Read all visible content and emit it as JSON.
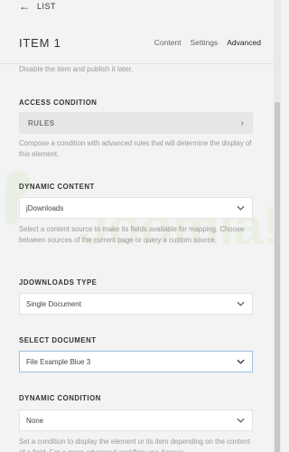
{
  "nav": {
    "back_label": "LIST"
  },
  "header": {
    "title": "ITEM 1",
    "tabs": [
      {
        "label": "Content"
      },
      {
        "label": "Settings"
      },
      {
        "label": "Advanced"
      }
    ]
  },
  "cut_off_text": "Disable the item and publish it later.",
  "access_condition": {
    "label": "ACCESS CONDITION",
    "rules_label": "RULES",
    "help": "Compose a condition with advanced rules that will determine the display of this element."
  },
  "dynamic_content": {
    "label": "DYNAMIC CONTENT",
    "value": "jDownloads",
    "help": "Select a content source to make its fields available for mapping. Choose between sources of the current page or query a custom source."
  },
  "jdownloads_type": {
    "label": "JDOWNLOADS TYPE",
    "value": "Single Document"
  },
  "select_document": {
    "label": "SELECT DOCUMENT",
    "value": "File Example Blue 3"
  },
  "dynamic_condition": {
    "label": "DYNAMIC CONDITION",
    "value": "None",
    "help": "Set a condition to display the element or its item depending on the content of a field. For a more advanced workflow use Access"
  },
  "colors": {
    "background": "#f3f3f3",
    "focus_border": "#9ec2e8",
    "watermark": "#e2ecd6"
  }
}
